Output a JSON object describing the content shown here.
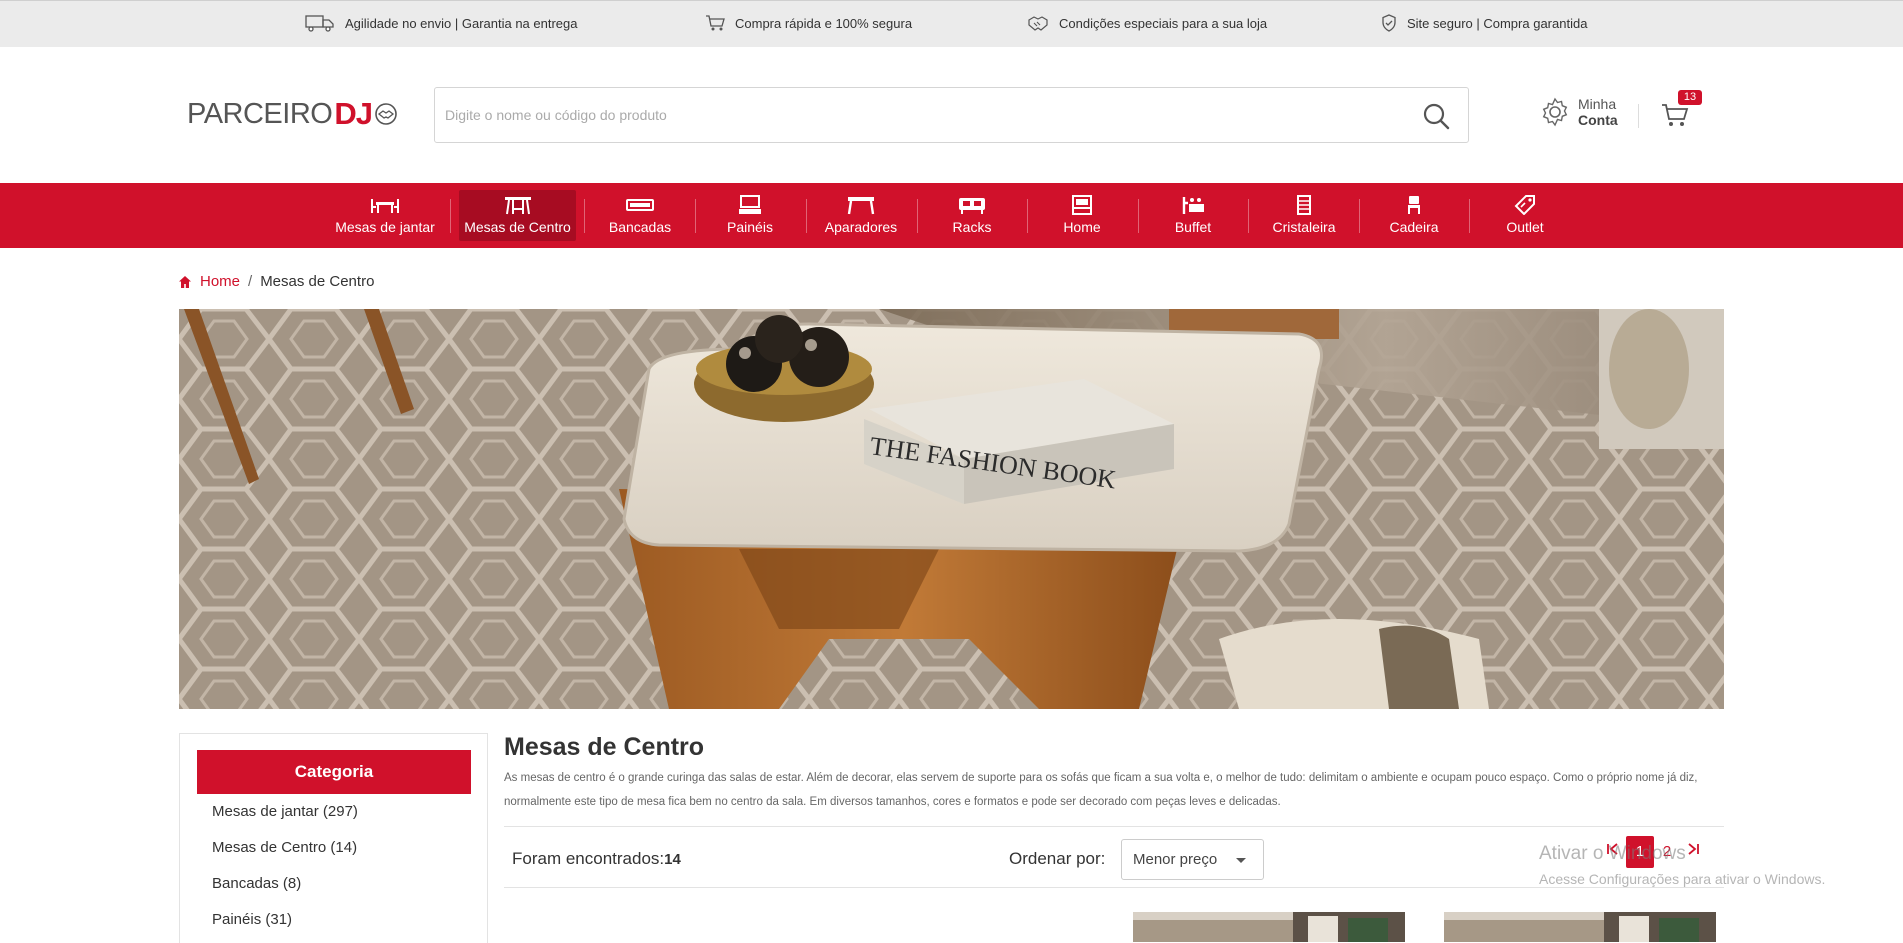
{
  "topbar": {
    "items": [
      {
        "icon": "truck-icon",
        "text": "Agilidade no envio  |  Garantia na entrega"
      },
      {
        "icon": "cart-icon",
        "text": "Compra rápida e 100% segura"
      },
      {
        "icon": "handshake-icon",
        "text": "Condições especiais para a sua loja"
      },
      {
        "icon": "shield-icon",
        "text": "Site seguro | Compra garantida"
      }
    ]
  },
  "header": {
    "logo_text": "PARCEIRO",
    "logo_accent": "DJ",
    "search_placeholder": "Digite o nome ou código do produto",
    "account_line1": "Minha",
    "account_line2": "Conta",
    "cart_count": "13"
  },
  "nav": {
    "items": [
      {
        "label": "Mesas de jantar",
        "icon": "dining-table-icon"
      },
      {
        "label": "Mesas de Centro",
        "icon": "coffee-table-icon",
        "active": true
      },
      {
        "label": "Bancadas",
        "icon": "bench-icon"
      },
      {
        "label": "Painéis",
        "icon": "tv-panel-icon"
      },
      {
        "label": "Aparadores",
        "icon": "sideboard-icon"
      },
      {
        "label": "Racks",
        "icon": "rack-icon"
      },
      {
        "label": "Home",
        "icon": "home-unit-icon"
      },
      {
        "label": "Buffet",
        "icon": "buffet-icon"
      },
      {
        "label": "Cristaleira",
        "icon": "cabinet-icon"
      },
      {
        "label": "Cadeira",
        "icon": "chair-icon"
      },
      {
        "label": "Outlet",
        "icon": "tag-icon"
      }
    ]
  },
  "breadcrumb": {
    "home": "Home",
    "separator": "/",
    "current": "Mesas de Centro"
  },
  "banner": {
    "book_text": "THE FASHION BOOK"
  },
  "sidebar": {
    "heading": "Categoria",
    "items": [
      "Mesas de jantar (297)",
      "Mesas de Centro (14)",
      "Bancadas (8)",
      "Painéis (31)"
    ]
  },
  "content": {
    "title": "Mesas de Centro",
    "description": "As mesas de centro é o grande curinga das salas de estar. Além de decorar, elas servem de suporte para os sofás que ficam a sua volta e, o melhor de tudo: delimitam o ambiente e ocupam pouco espaço. Como o próprio nome já diz, normalmente este tipo de mesa fica bem no centro da sala. Em diversos tamanhos, cores e formatos e pode ser decorado com peças leves e delicadas.",
    "found_label": "Foram encontrados:",
    "found_count": "14",
    "sort_label": "Ordenar por:",
    "sort_value": "Menor preço",
    "pages": [
      "1",
      "2"
    ],
    "current_page": "1"
  },
  "watermark": {
    "line1": "Ativar o Windows",
    "line2": "Acesse Configurações para ativar o Windows."
  },
  "colors": {
    "brand_red": "#d0112b",
    "nav_active": "#a70c22"
  }
}
